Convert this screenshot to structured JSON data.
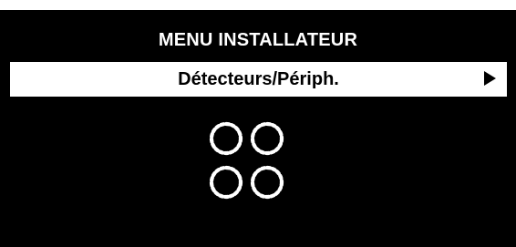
{
  "menu": {
    "title": "MENU INSTALLATEUR",
    "selected_item": "Détecteurs/Périph.",
    "arrow_icon": "right-triangle-icon"
  },
  "status": {
    "loading_icon": "loading-spinner-icon"
  },
  "colors": {
    "screen_background": "#000000",
    "text": "#ffffff",
    "highlight_background": "#ffffff",
    "highlight_text": "#000000"
  }
}
